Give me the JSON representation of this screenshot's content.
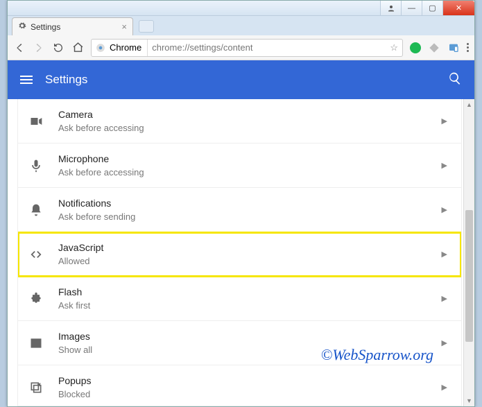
{
  "tab": {
    "title": "Settings"
  },
  "omnibox": {
    "scheme_label": "Chrome",
    "url": "chrome://settings/content"
  },
  "header": {
    "title": "Settings"
  },
  "rows": [
    {
      "title": "Camera",
      "sub": "Ask before accessing"
    },
    {
      "title": "Microphone",
      "sub": "Ask before accessing"
    },
    {
      "title": "Notifications",
      "sub": "Ask before sending"
    },
    {
      "title": "JavaScript",
      "sub": "Allowed"
    },
    {
      "title": "Flash",
      "sub": "Ask first"
    },
    {
      "title": "Images",
      "sub": "Show all"
    },
    {
      "title": "Popups",
      "sub": "Blocked"
    }
  ],
  "watermark": "©WebSparrow.org"
}
